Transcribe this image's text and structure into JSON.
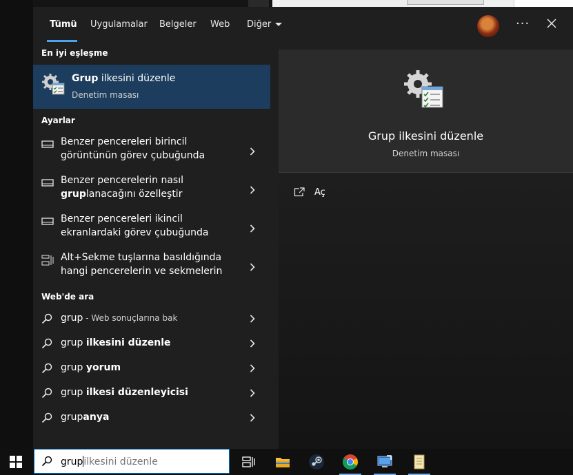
{
  "tabs": [
    {
      "label": "Tümü",
      "active": true
    },
    {
      "label": "Uygulamalar"
    },
    {
      "label": "Belgeler"
    },
    {
      "label": "Web"
    },
    {
      "label": "Diğer"
    }
  ],
  "sections": {
    "best_match": "En iyi eşleşme",
    "settings": "Ayarlar",
    "web": "Web'de ara"
  },
  "best_match": {
    "title_bold": "Grup",
    "title_rest": " ilkesini düzenle",
    "subtitle": "Denetim masası"
  },
  "settings_items": [
    {
      "line1": "Benzer pencereleri birincil",
      "line2": "görüntünün görev çubuğunda",
      "icon": "monitor-icon"
    },
    {
      "line1": "Benzer pencerelerin nasıl",
      "line2_bold": "grup",
      "line2_rest": "lanacağını özelleştir",
      "icon": "monitor-icon"
    },
    {
      "line1": "Benzer pencereleri ikincil",
      "line2": "ekranlardaki görev çubuğunda",
      "icon": "monitor-icon"
    },
    {
      "line1": "Alt+Sekme tuşlarına basıldığında",
      "line2": "hangi pencerelerin ve sekmelerin",
      "icon": "task-view-icon"
    }
  ],
  "web_items": [
    {
      "prefix": "grup",
      "bold": "",
      "suffix": " - Web sonuçlarına bak"
    },
    {
      "prefix": "grup ",
      "bold": "ilkesini düzenle",
      "suffix": ""
    },
    {
      "prefix": "grup ",
      "bold": "yorum",
      "suffix": ""
    },
    {
      "prefix": "grup ",
      "bold": "ilkesi düzenleyicisi",
      "suffix": ""
    },
    {
      "prefix": "grup",
      "bold": "anya",
      "suffix": ""
    }
  ],
  "preview": {
    "title": "Grup ilkesini düzenle",
    "subtitle": "Denetim masası",
    "action_open": "Aç"
  },
  "search": {
    "typed": "grup",
    "suggestion": "ilkesini düzenle"
  },
  "colors": {
    "accent": "#4aa3f0",
    "selection": "#1d3d5e",
    "panel": "#1f1f1f"
  }
}
